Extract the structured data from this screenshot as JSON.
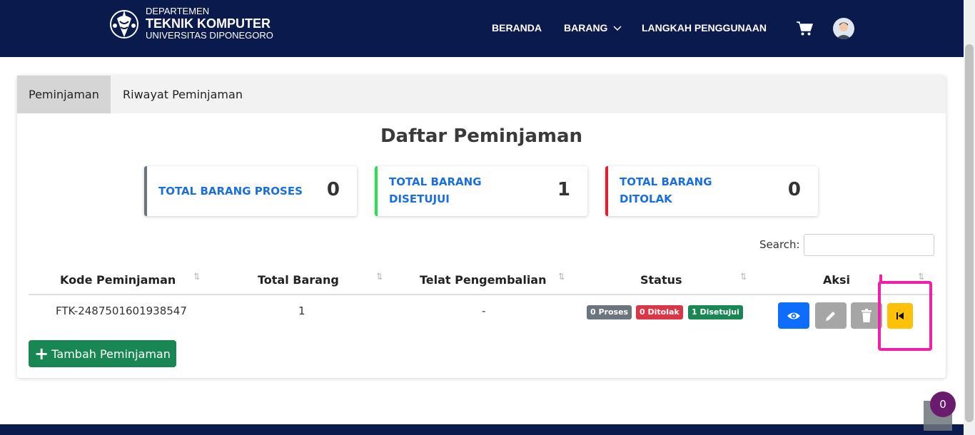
{
  "header": {
    "brand_line1": "DEPARTEMEN",
    "brand_line2": "TEKNIK KOMPUTER",
    "brand_line3": "UNIVERSITAS DIPONEGORO",
    "nav": [
      "BERANDA",
      "BARANG",
      "LANGKAH PENGGUNAAN"
    ],
    "icons": [
      "logo-icon",
      "chevron-down-icon",
      "cart-icon",
      "avatar"
    ]
  },
  "tabs": [
    "Peminjaman",
    "Riwayat Peminjaman"
  ],
  "title": "Daftar Peminjaman",
  "stats": [
    {
      "label_line1": "TOTAL BARANG PROSES",
      "label_line2": "",
      "value": "0",
      "color": "#6c757d"
    },
    {
      "label_line1": "TOTAL BARANG",
      "label_line2": "DISETUJUI",
      "value": "1",
      "color": "#28e050"
    },
    {
      "label_line1": "TOTAL BARANG",
      "label_line2": "DITOLAK",
      "value": "0",
      "color": "#e0202e"
    }
  ],
  "search": {
    "label": "Search:",
    "placeholder": ""
  },
  "table": {
    "headers": [
      "Kode Peminjaman",
      "Total Barang",
      "Telat Pengembalian",
      "Status",
      "Aksi"
    ],
    "sort_icon": "⭡⭣",
    "rows": [
      {
        "kode": "FTK-2487501601938547",
        "total": "1",
        "telat": "-",
        "badges": [
          "0 Proses",
          "0 Ditolak",
          "1 Disetujui"
        ]
      }
    ]
  },
  "actions": [
    "eye-icon",
    "pencil-icon",
    "trash-icon",
    "return-icon"
  ],
  "add_button": {
    "label": "Tambah Peminjaman",
    "icon": "+"
  },
  "notification_count": "0",
  "colors": {
    "navbar": "#0b1a4d",
    "primary": "#0d6efd",
    "success": "#198754",
    "danger": "#dc3545",
    "secondary": "#6c757d",
    "warning": "#ffc107",
    "highlight": "#f020a8"
  }
}
